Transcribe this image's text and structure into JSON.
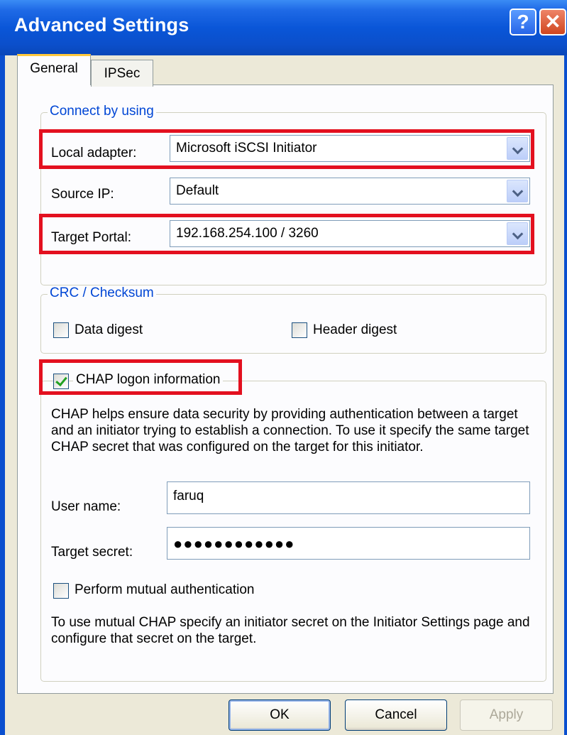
{
  "window": {
    "title": "Advanced Settings",
    "help_glyph": "?",
    "close_glyph": "✕"
  },
  "tabs": [
    {
      "label": "General",
      "active": true
    },
    {
      "label": "IPSec",
      "active": false
    }
  ],
  "connect": {
    "legend": "Connect by using",
    "local_adapter": {
      "label": "Local adapter:",
      "value": "Microsoft iSCSI Initiator"
    },
    "source_ip": {
      "label": "Source IP:",
      "value": "Default"
    },
    "target_portal": {
      "label": "Target Portal:",
      "value": "192.168.254.100 / 3260"
    }
  },
  "crc": {
    "legend": "CRC / Checksum",
    "data_digest": {
      "label": "Data digest",
      "checked": false
    },
    "header_digest": {
      "label": "Header digest",
      "checked": false
    }
  },
  "chap": {
    "checkbox_label": "CHAP logon information",
    "checked": true,
    "description": "CHAP helps ensure data security by providing authentication between a target and an initiator trying to establish a connection. To use it specify the same target CHAP secret that was configured on the target for this initiator.",
    "user_name": {
      "label": "User name:",
      "value": "faruq"
    },
    "target_secret": {
      "label": "Target secret:",
      "value": "●●●●●●●●●●●●"
    },
    "mutual": {
      "label": "Perform mutual authentication",
      "checked": false
    },
    "mutual_note": "To use mutual CHAP specify an initiator secret on the Initiator Settings page and configure that secret on the target."
  },
  "buttons": {
    "ok": "OK",
    "cancel": "Cancel",
    "apply": "Apply"
  },
  "colors": {
    "highlight": "#e3101f",
    "titlebar": "#0a56d8",
    "legend_text": "#0046d5",
    "dialog_bg": "#ece9d8"
  }
}
